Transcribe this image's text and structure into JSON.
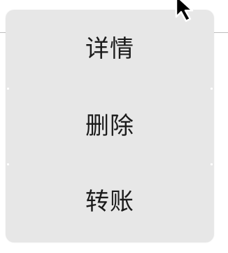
{
  "context_menu": {
    "items": [
      {
        "label": "详情"
      },
      {
        "label": "删除"
      },
      {
        "label": "转账"
      }
    ]
  },
  "colors": {
    "menu_background": "#e7e7e7",
    "text": "#1b1b1b",
    "divider_line": "#bdbdbd"
  },
  "icons": {
    "cursor": "mouse-pointer-icon"
  }
}
